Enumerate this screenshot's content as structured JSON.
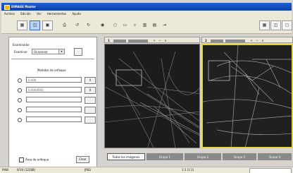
{
  "window": {
    "title": "DIMAGE Master"
  },
  "menu": [
    "Archivo",
    "Edición",
    "Ver",
    "Herramientas",
    "Ayuda"
  ],
  "toolbar": {
    "left_icons": [
      "thumbnails-icon",
      "compare-icon",
      "single-view-icon",
      "print-icon",
      "rotate-left-icon",
      "rotate-right-icon",
      "camera-icon",
      "circle-select-icon",
      "fit-icon",
      "zoom-icon",
      "histogram-icon",
      "info-icon",
      "send-icon"
    ],
    "right_icons": [
      "layout-grid-icon",
      "layout-split-icon",
      "layout-single-icon"
    ]
  },
  "sidebar": {
    "section_label": "Examinador",
    "scale_label": "Examinar",
    "scale_value": "Ocasional",
    "focus_title": "Medidas de enfoque",
    "focus_rows": [
      {
        "value": "0.000",
        "button": "X"
      },
      {
        "value": "0.0000000",
        "button": "X"
      },
      {
        "value": "",
        "button": ""
      },
      {
        "value": "",
        "button": ""
      },
      {
        "value": "",
        "button": ""
      }
    ],
    "checkbox_label": "Área de enfoque",
    "clear_button": "Clear"
  },
  "panes": [
    {
      "number": "1",
      "controls": [
        "+",
        "—",
        "×"
      ]
    },
    {
      "number": "2",
      "controls": [
        "+",
        "—",
        "×"
      ]
    }
  ],
  "tabs": [
    "Todas las imágenes",
    "Grupo 1",
    "Grupo 2",
    "Grupo 3",
    "Grupo 4"
  ],
  "status": {
    "left": "RAW",
    "middle": "0/16 (12288)",
    "format": "JPEG",
    "zoom": "1:1 (1:1)"
  }
}
